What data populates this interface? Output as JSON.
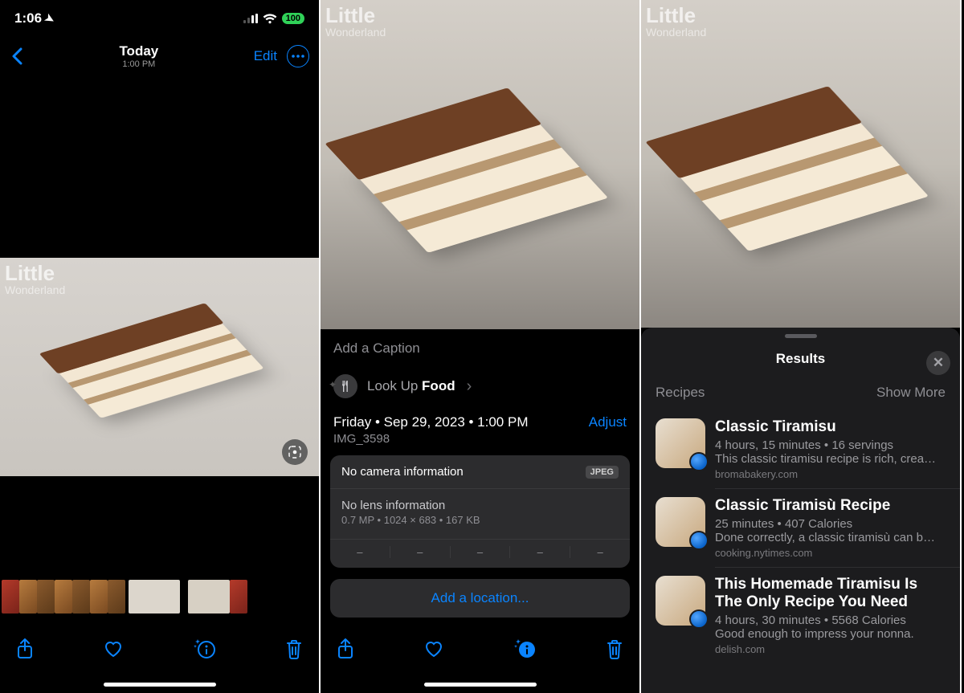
{
  "status": {
    "time": "1:06",
    "battery": "100"
  },
  "nav": {
    "title": "Today",
    "subtitle": "1:00 PM",
    "edit": "Edit"
  },
  "watermark": {
    "line1": "Little",
    "line2": "Wonderland"
  },
  "pane2": {
    "caption_placeholder": "Add a Caption",
    "lookup_prefix": "Look Up ",
    "lookup_category": "Food",
    "date_line": "Friday • Sep 29, 2023 • 1:00 PM",
    "adjust": "Adjust",
    "image_name": "IMG_3598",
    "camera_info": "No camera information",
    "jpeg": "JPEG",
    "lens_info": "No lens information",
    "spec_line": "0.7 MP  •  1024 × 683  •  167 KB",
    "dash": "–",
    "add_location": "Add a location..."
  },
  "pane3": {
    "results_title": "Results",
    "section": "Recipes",
    "show_more": "Show More",
    "recipes": [
      {
        "title": "Classic Tiramisu",
        "meta": "4 hours, 15 minutes • 16 servings",
        "desc": "This classic tiramisu recipe is rich, crea…",
        "source": "bromabakery.com"
      },
      {
        "title": "Classic Tiramisù Recipe",
        "meta": "25 minutes • 407 Calories",
        "desc": "Done correctly, a classic tiramisù can b…",
        "source": "cooking.nytimes.com"
      },
      {
        "title": "This Homemade Tiramisu Is The Only Recipe You Need",
        "meta": "4 hours, 30 minutes • 5568 Calories",
        "desc": "Good enough to impress your nonna.",
        "source": "delish.com"
      }
    ]
  }
}
